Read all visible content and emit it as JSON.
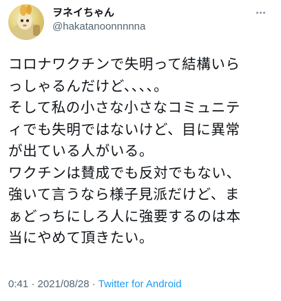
{
  "author": {
    "display_name": "ヲネイちゃん",
    "handle": "@hakatanoonnnnna"
  },
  "tweet": {
    "lines": [
      "コロナワクチンで失明って結構いら",
      "っしゃるんだけど、、、、。",
      "そして私の小さな小さなコミュニテ",
      "ィでも失明ではないけど、目に異常",
      "が出ている人がいる。",
      "ワクチンは賛成でも反対でもない、",
      "強いて言うなら様子見派だけど、ま",
      "ぁどっちにしろ人に強要するのは本",
      "当にやめて頂きたい。"
    ]
  },
  "meta": {
    "time": "0:41",
    "separator": "·",
    "date": "2021/08/28",
    "source": "Twitter for Android"
  },
  "icons": {
    "avatar": "avatar-character-icon",
    "more": "more-options-icon"
  }
}
